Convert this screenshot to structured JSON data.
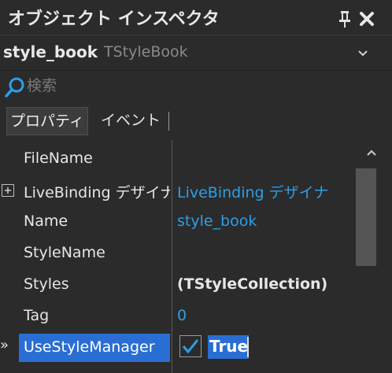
{
  "panel": {
    "title": "オブジェクト インスペクタ",
    "pin_icon": "pin-icon",
    "close_icon": "close-icon"
  },
  "component": {
    "name": "style_book",
    "type": "TStyleBook",
    "dropdown_icon": "chevron-down-icon"
  },
  "search": {
    "placeholder": "検索",
    "value": "",
    "icon": "search-icon"
  },
  "tabs": [
    {
      "label": "プロパティ",
      "active": true
    },
    {
      "label": "イベント",
      "active": false
    }
  ],
  "properties": [
    {
      "name": "FileName",
      "value": "",
      "style": "normal"
    },
    {
      "name": "LiveBinding デザイナ",
      "value": "LiveBinding デザイナ",
      "style": "link",
      "expandable": true,
      "expanded": false
    },
    {
      "name": "Name",
      "value": "style_book",
      "style": "link"
    },
    {
      "name": "StyleName",
      "value": "",
      "style": "normal"
    },
    {
      "name": "Styles",
      "value": "(TStyleCollection)",
      "style": "bold"
    },
    {
      "name": "Tag",
      "value": "0",
      "style": "link"
    },
    {
      "name": "UseStyleManager",
      "value": "True",
      "style": "bold",
      "selected": true,
      "checked": true
    }
  ],
  "selected_marker": "»",
  "colors": {
    "background": "#2b2b2b",
    "selection": "#2a6ed3",
    "link_value": "#2d9fe8",
    "text": "#e6e6e6"
  }
}
